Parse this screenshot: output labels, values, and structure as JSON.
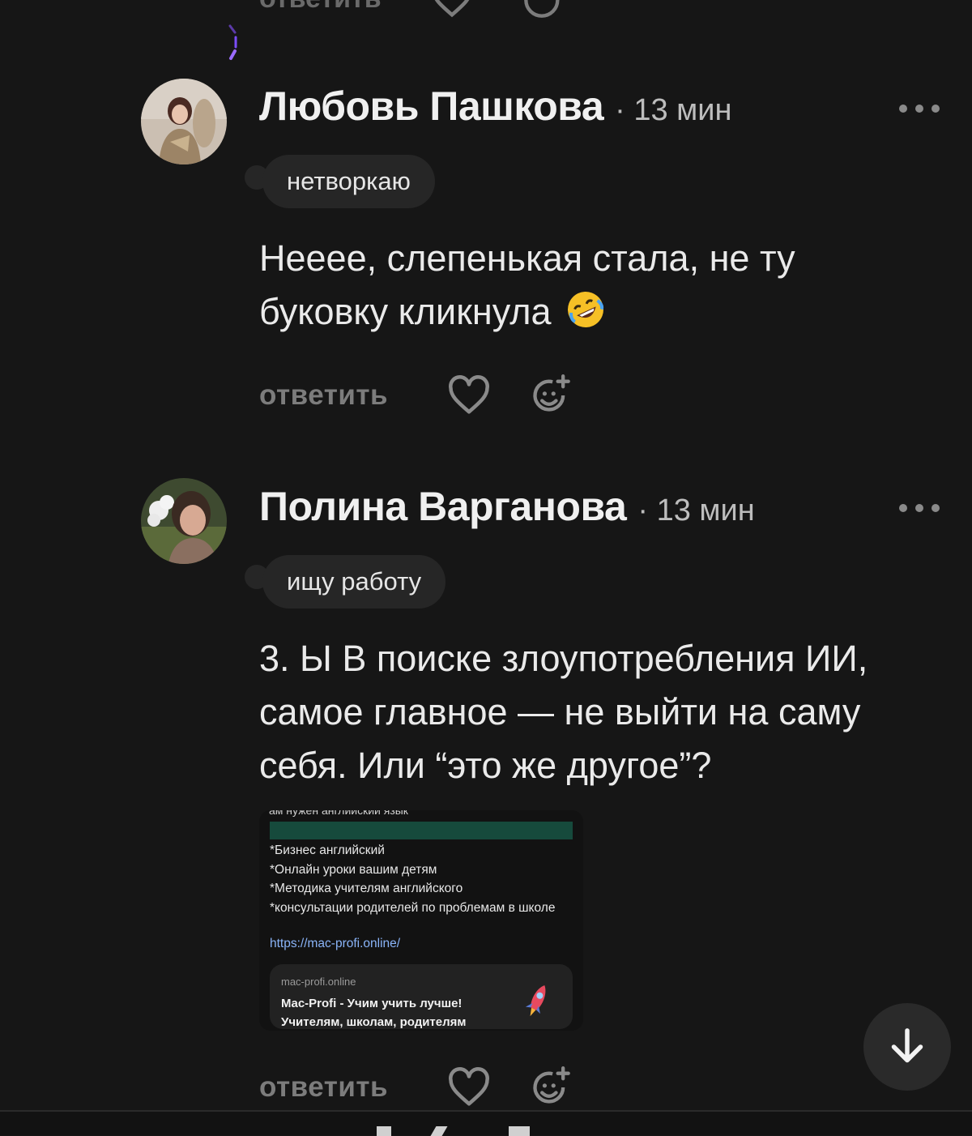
{
  "top_partial": {
    "reply_label": "ответить"
  },
  "comments": [
    {
      "author": "Любовь Пашкова",
      "time": "· 13 мин",
      "status": "нетворкаю",
      "text": "Неeee, слепенькая стала, не ту буковку кликнула",
      "emoji": "rolling-on-floor-laughing-emoji",
      "reply_label": "ответить"
    },
    {
      "author": "Полина Варганова",
      "time": "· 13 мин",
      "status": "ищу работу",
      "text": "3. Ы В поиске злоупотребления ИИ, самое главное — не выйти на саму себя. Или “это же другое”?",
      "reply_label": "ответить",
      "attachment": {
        "cut_heading": "ам нужен английский язык",
        "lines": [
          "*Бизнес английский",
          "*Онлайн уроки вашим детям",
          "*Методика учителям английского",
          "*консультации родителей по проблемам в школе"
        ],
        "link": "https://mac-profi.online/",
        "preview": {
          "host": "mac-profi.online",
          "title": "Mac-Profi - Учим учить лучше!",
          "subtitle": "Учителям, школам, родителям"
        }
      }
    }
  ],
  "icons": {
    "more": "more-dots-icon",
    "like": "heart-icon",
    "react": "add-reaction-icon",
    "scroll": "arrow-down-icon"
  },
  "colors": {
    "background": "#161616",
    "chip": "#262626",
    "story_ring": "#8b5cf6",
    "muted": "#7c7c7c"
  }
}
